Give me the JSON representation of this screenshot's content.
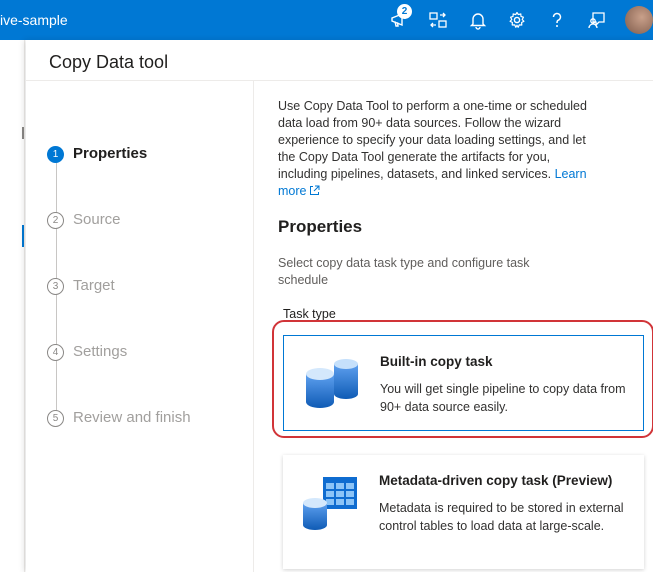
{
  "topbar": {
    "app_title": "ive-sample",
    "notification_count": "2"
  },
  "panel": {
    "title": "Copy Data tool"
  },
  "stepper": {
    "steps": [
      {
        "number": "1",
        "label": "Properties",
        "state": "active"
      },
      {
        "number": "2",
        "label": "Source",
        "state": "pending"
      },
      {
        "number": "3",
        "label": "Target",
        "state": "pending"
      },
      {
        "number": "4",
        "label": "Settings",
        "state": "pending"
      },
      {
        "number": "5",
        "label": "Review and finish",
        "state": "pending"
      }
    ]
  },
  "content": {
    "intro": "Use Copy Data Tool to perform a one-time or scheduled data load from 90+ data sources. Follow the wizard experience to specify your data loading settings, and let the Copy Data Tool generate the artifacts for you, including pipelines, datasets, and linked services.",
    "learn_more": "Learn more",
    "section_title": "Properties",
    "section_desc": "Select copy data task type and configure task schedule",
    "task_type_label": "Task type",
    "cards": [
      {
        "title": "Built-in copy task",
        "desc": "You will get single pipeline to copy data from 90+ data source easily.",
        "selected": true
      },
      {
        "title": "Metadata-driven copy task (Preview)",
        "desc": "Metadata is required to be stored in external control tables to load data at large-scale.",
        "selected": false
      }
    ]
  },
  "colors": {
    "accent": "#0078d4",
    "highlight": "#d13438"
  }
}
